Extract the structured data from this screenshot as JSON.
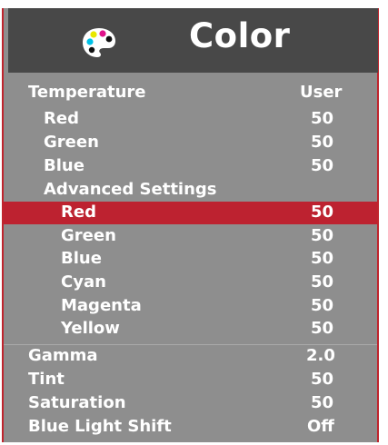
{
  "menu": {
    "title": "Color",
    "icon": "palette-icon",
    "colors": {
      "accent": "#bd2230",
      "panel": "#8e8e8e",
      "header": "#484848"
    },
    "temperature": {
      "label": "Temperature",
      "value": "User"
    },
    "red": {
      "label": "Red",
      "value": "50"
    },
    "green": {
      "label": "Green",
      "value": "50"
    },
    "blue": {
      "label": "Blue",
      "value": "50"
    },
    "advanced": {
      "label": "Advanced Settings",
      "red": {
        "label": "Red",
        "value": "50"
      },
      "green": {
        "label": "Green",
        "value": "50"
      },
      "blue": {
        "label": "Blue",
        "value": "50"
      },
      "cyan": {
        "label": "Cyan",
        "value": "50"
      },
      "magenta": {
        "label": "Magenta",
        "value": "50"
      },
      "yellow": {
        "label": "Yellow",
        "value": "50"
      }
    },
    "gamma": {
      "label": "Gamma",
      "value": "2.0"
    },
    "tint": {
      "label": "Tint",
      "value": "50"
    },
    "saturation": {
      "label": "Saturation",
      "value": "50"
    },
    "blue_light_shift": {
      "label": "Blue Light Shift",
      "value": "Off"
    }
  }
}
